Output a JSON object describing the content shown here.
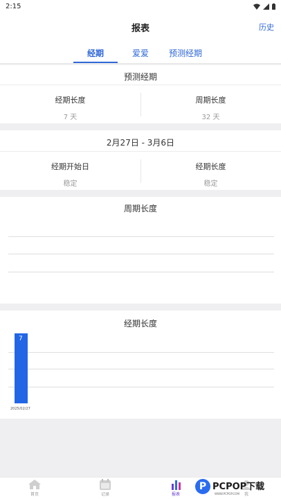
{
  "status": {
    "time": "2:15"
  },
  "header": {
    "title": "报表",
    "history_label": "历史"
  },
  "tabs": [
    "经期",
    "爱爱",
    "预测经期"
  ],
  "predicted": {
    "title": "预测经期",
    "cols": [
      {
        "label": "经期长度",
        "value": "7 天"
      },
      {
        "label": "周期长度",
        "value": "32 天"
      }
    ]
  },
  "period": {
    "date_range": "2月27日 - 3月6日",
    "cols": [
      {
        "label": "经期开始日",
        "value": "稳定"
      },
      {
        "label": "经期长度",
        "value": "稳定"
      }
    ]
  },
  "cycle_chart": {
    "title": "周期长度"
  },
  "chart_data": {
    "type": "bar",
    "title": "经期长度",
    "categories": [
      "2025/02/27"
    ],
    "values": [
      7
    ],
    "data_labels": [
      "7"
    ],
    "color": "#2266e6",
    "grid": true
  },
  "tabbar": {
    "items": [
      {
        "label": "首页",
        "icon": "home-icon"
      },
      {
        "label": "记录",
        "icon": "calendar-icon"
      },
      {
        "label": "报表",
        "icon": "bar-chart-icon"
      },
      {
        "label": "我",
        "icon": "user-icon"
      }
    ]
  },
  "watermark": {
    "brand": "PCPOP下载",
    "mark": "P",
    "sub": "WWW.PCPOP.COM"
  },
  "colors": {
    "accent": "#2f67d8",
    "bar": "#2266e6",
    "active_tab_icon": "#6b3fd0"
  }
}
